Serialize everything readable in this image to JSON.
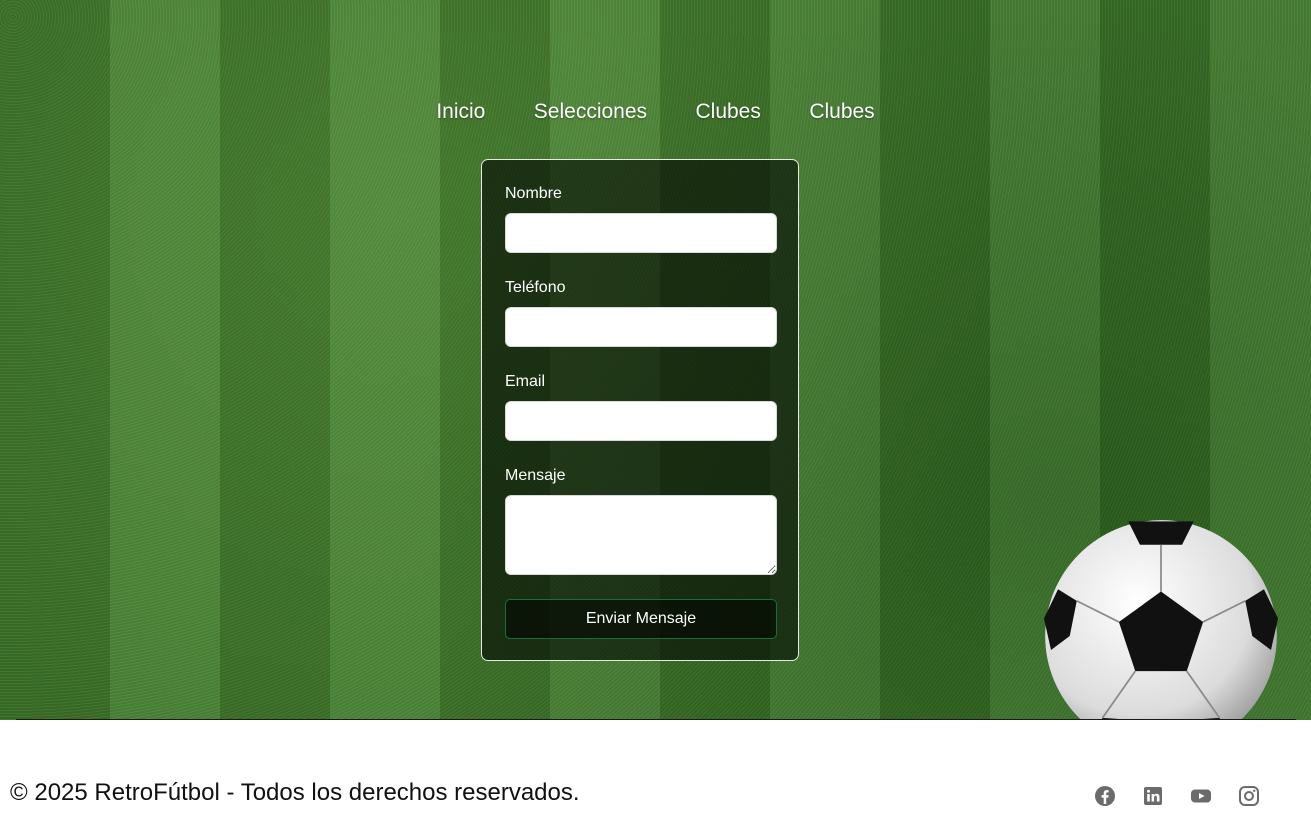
{
  "nav": {
    "items": [
      {
        "label": "Inicio"
      },
      {
        "label": "Selecciones"
      },
      {
        "label": "Clubes"
      },
      {
        "label": "Clubes"
      }
    ]
  },
  "form": {
    "fields": {
      "nombre": {
        "label": "Nombre",
        "value": ""
      },
      "telefono": {
        "label": "Teléfono",
        "value": ""
      },
      "email": {
        "label": "Email",
        "value": ""
      },
      "mensaje": {
        "label": "Mensaje",
        "value": ""
      }
    },
    "submit_label": "Enviar Mensaje"
  },
  "footer": {
    "copyright": "© 2025 RetroFútbol - Todos los derechos reservados.",
    "social_icons": [
      "facebook-icon",
      "linkedin-icon",
      "youtube-icon",
      "instagram-icon"
    ]
  },
  "colors": {
    "grass": "#3f7a2a",
    "button_border": "#1b6e3a",
    "social_icon": "#6b6b6b"
  }
}
